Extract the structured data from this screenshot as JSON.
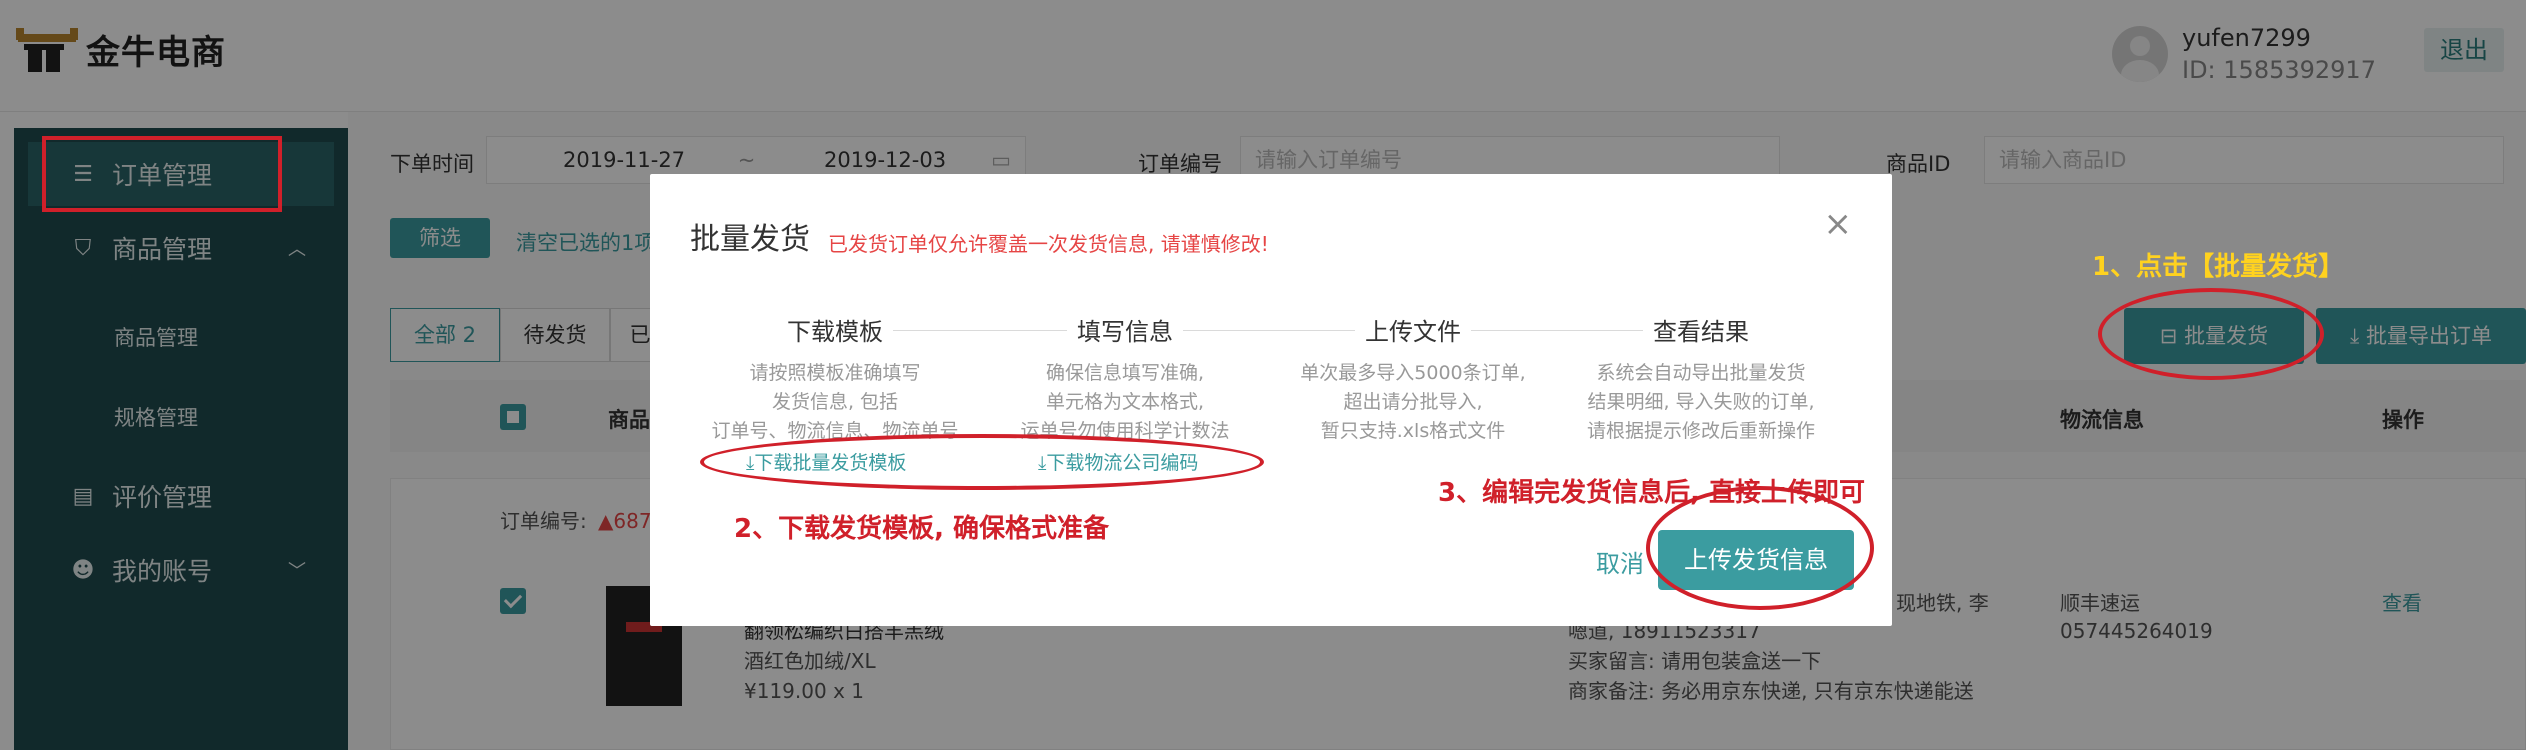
{
  "header": {
    "logo_text": "金牛电商",
    "user_name": "yufen7299",
    "user_id": "ID: 1585392917",
    "logout": "退出"
  },
  "sidebar": {
    "items": [
      {
        "label": "订单管理",
        "icon": "list-icon"
      },
      {
        "label": "商品管理",
        "icon": "basket-icon"
      },
      {
        "label": "商品管理"
      },
      {
        "label": "规格管理"
      },
      {
        "label": "评价管理",
        "icon": "comment-icon"
      },
      {
        "label": "我的账号",
        "icon": "face-icon"
      }
    ]
  },
  "filters": {
    "order_time_label": "下单时间",
    "date_start": "2019-11-27",
    "date_sep": "~",
    "date_end": "2019-12-03",
    "order_no_label": "订单编号",
    "order_no_placeholder": "请输入订单编号",
    "product_id_label": "商品ID",
    "product_id_placeholder": "请输入商品ID",
    "filter_button": "筛选",
    "clear_text": "清空已选的1项"
  },
  "tabs": [
    "全部 2",
    "待发货",
    "已"
  ],
  "actions": {
    "batch_ship": "批量发货",
    "batch_export": "批量导出订单"
  },
  "table": {
    "headers": [
      "商品",
      "物流信息",
      "操作"
    ]
  },
  "order": {
    "order_no_label": "订单编号:",
    "order_no": "▲687",
    "product_name": "翻领松编织白搭羊羔绒",
    "product_spec": "酒红色加绒/XL",
    "product_price": "¥119.00 x 1",
    "address_tail": "现地铁, 李",
    "phone": "嗯道, 18911523317",
    "buyer_msg": "买家留言: 请用包装盒送一下",
    "seller_note": "商家备注: 务必用京东快递, 只有京东快递能送",
    "courier": "顺丰速运",
    "tracking_no": "057445264019",
    "view": "查看"
  },
  "modal": {
    "title": "批量发货",
    "warning": "已发货订单仅允许覆盖一次发货信息, 请谨慎修改!",
    "steps": [
      {
        "title": "下载模板",
        "desc": [
          "请按照模板准确填写",
          "发货信息, 包括",
          "订单号、物流信息、物流单号"
        ]
      },
      {
        "title": "填写信息",
        "desc": [
          "确保信息填写准确,",
          "单元格为文本格式,",
          "运单号勿使用科学计数法"
        ]
      },
      {
        "title": "上传文件",
        "desc": [
          "单次最多导入5000条订单,",
          "超出请分批导入,",
          "暂只支持.xls格式文件"
        ]
      },
      {
        "title": "查看结果",
        "desc": [
          "系统会自动导出批量发货",
          "结果明细, 导入失败的订单,",
          "请根据提示修改后重新操作"
        ]
      }
    ],
    "link_template": "下载批量发货模板",
    "link_courier": "下载物流公司编码",
    "cancel": "取消",
    "upload": "上传发货信息"
  },
  "annotations": {
    "step1": "1、点击【批量发货】",
    "step2": "2、下载发货模板, 确保格式准备",
    "step3": "3、编辑完发货信息后, 直接上传即可"
  },
  "colors": {
    "accent": "#3b9ca0",
    "sidebar": "#1f4b4f",
    "annotation_red": "#d0202a",
    "annotation_yellow": "#ffd21f"
  }
}
